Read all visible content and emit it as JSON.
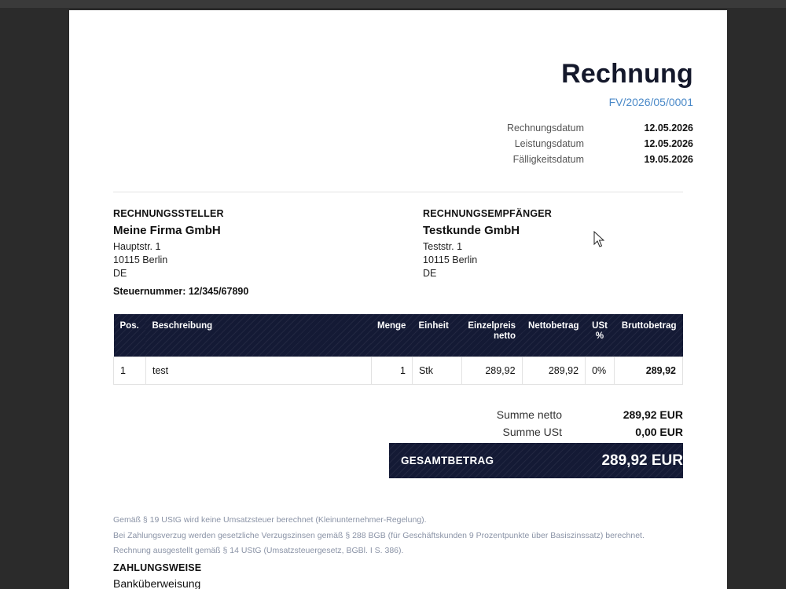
{
  "invoice": {
    "title": "Rechnung",
    "number": "FV/2026/05/0001",
    "meta": [
      {
        "label": "Rechnungsdatum",
        "value": "12.05.2026"
      },
      {
        "label": "Leistungsdatum",
        "value": "12.05.2026"
      },
      {
        "label": "Fälligkeitsdatum",
        "value": "19.05.2026"
      }
    ]
  },
  "sender": {
    "heading": "RECHNUNGSSTELLER",
    "name": "Meine Firma GmbH",
    "street": "Hauptstr. 1",
    "city": "10115 Berlin",
    "country": "DE",
    "tax_id": "Steuernummer: 12/345/67890"
  },
  "recipient": {
    "heading": "RECHNUNGSEMPFÄNGER",
    "name": "Testkunde GmbH",
    "street": "Teststr. 1",
    "city": "10115 Berlin",
    "country": "DE"
  },
  "items_table": {
    "headers": {
      "pos": "Pos.",
      "description": "Beschreibung",
      "quantity": "Menge",
      "unit": "Einheit",
      "unit_price_1": "Einzelpreis",
      "unit_price_2": "netto",
      "net_amount": "Nettobetrag",
      "vat_1": "USt",
      "vat_2": "%",
      "gross_amount": "Bruttobetrag"
    },
    "rows": [
      {
        "pos": "1",
        "description": "test",
        "quantity": "1",
        "unit": "Stk",
        "unit_price": "289,92",
        "net_amount": "289,92",
        "vat": "0%",
        "gross_amount": "289,92"
      }
    ]
  },
  "totals": {
    "net_label": "Summe netto",
    "net_value": "289,92 EUR",
    "vat_label": "Summe USt",
    "vat_value": "0,00 EUR",
    "grand_label": "GESAMTBETRAG",
    "grand_value": "289,92 EUR"
  },
  "notes": [
    "Gemäß § 19 UStG wird keine Umsatzsteuer berechnet (Kleinunternehmer-Regelung).",
    "Bei Zahlungsverzug werden gesetzliche Verzugszinsen gemäß § 288 BGB (für Geschäftskunden 9 Prozentpunkte über Basiszinssatz) berechnet.",
    "Rechnung ausgestellt gemäß § 14 UStG (Umsatzsteuergesetz, BGBl. I S. 386)."
  ],
  "payment": {
    "heading": "ZAHLUNGSWEISE",
    "method": "Banküberweisung"
  },
  "icons": {
    "cursor": "mouse-pointer-icon"
  },
  "colors": {
    "header_bg": "#141a35",
    "number_blue": "#4a89c8",
    "note_gray": "#8a93a6"
  }
}
